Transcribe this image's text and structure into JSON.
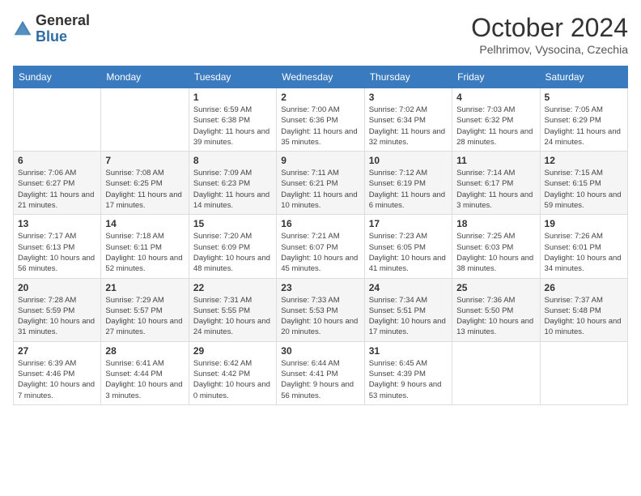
{
  "header": {
    "logo_general": "General",
    "logo_blue": "Blue",
    "month_title": "October 2024",
    "subtitle": "Pelhrimov, Vysocina, Czechia"
  },
  "calendar": {
    "days_of_week": [
      "Sunday",
      "Monday",
      "Tuesday",
      "Wednesday",
      "Thursday",
      "Friday",
      "Saturday"
    ],
    "weeks": [
      [
        {
          "day": "",
          "info": ""
        },
        {
          "day": "",
          "info": ""
        },
        {
          "day": "1",
          "info": "Sunrise: 6:59 AM\nSunset: 6:38 PM\nDaylight: 11 hours and 39 minutes."
        },
        {
          "day": "2",
          "info": "Sunrise: 7:00 AM\nSunset: 6:36 PM\nDaylight: 11 hours and 35 minutes."
        },
        {
          "day": "3",
          "info": "Sunrise: 7:02 AM\nSunset: 6:34 PM\nDaylight: 11 hours and 32 minutes."
        },
        {
          "day": "4",
          "info": "Sunrise: 7:03 AM\nSunset: 6:32 PM\nDaylight: 11 hours and 28 minutes."
        },
        {
          "day": "5",
          "info": "Sunrise: 7:05 AM\nSunset: 6:29 PM\nDaylight: 11 hours and 24 minutes."
        }
      ],
      [
        {
          "day": "6",
          "info": "Sunrise: 7:06 AM\nSunset: 6:27 PM\nDaylight: 11 hours and 21 minutes."
        },
        {
          "day": "7",
          "info": "Sunrise: 7:08 AM\nSunset: 6:25 PM\nDaylight: 11 hours and 17 minutes."
        },
        {
          "day": "8",
          "info": "Sunrise: 7:09 AM\nSunset: 6:23 PM\nDaylight: 11 hours and 14 minutes."
        },
        {
          "day": "9",
          "info": "Sunrise: 7:11 AM\nSunset: 6:21 PM\nDaylight: 11 hours and 10 minutes."
        },
        {
          "day": "10",
          "info": "Sunrise: 7:12 AM\nSunset: 6:19 PM\nDaylight: 11 hours and 6 minutes."
        },
        {
          "day": "11",
          "info": "Sunrise: 7:14 AM\nSunset: 6:17 PM\nDaylight: 11 hours and 3 minutes."
        },
        {
          "day": "12",
          "info": "Sunrise: 7:15 AM\nSunset: 6:15 PM\nDaylight: 10 hours and 59 minutes."
        }
      ],
      [
        {
          "day": "13",
          "info": "Sunrise: 7:17 AM\nSunset: 6:13 PM\nDaylight: 10 hours and 56 minutes."
        },
        {
          "day": "14",
          "info": "Sunrise: 7:18 AM\nSunset: 6:11 PM\nDaylight: 10 hours and 52 minutes."
        },
        {
          "day": "15",
          "info": "Sunrise: 7:20 AM\nSunset: 6:09 PM\nDaylight: 10 hours and 48 minutes."
        },
        {
          "day": "16",
          "info": "Sunrise: 7:21 AM\nSunset: 6:07 PM\nDaylight: 10 hours and 45 minutes."
        },
        {
          "day": "17",
          "info": "Sunrise: 7:23 AM\nSunset: 6:05 PM\nDaylight: 10 hours and 41 minutes."
        },
        {
          "day": "18",
          "info": "Sunrise: 7:25 AM\nSunset: 6:03 PM\nDaylight: 10 hours and 38 minutes."
        },
        {
          "day": "19",
          "info": "Sunrise: 7:26 AM\nSunset: 6:01 PM\nDaylight: 10 hours and 34 minutes."
        }
      ],
      [
        {
          "day": "20",
          "info": "Sunrise: 7:28 AM\nSunset: 5:59 PM\nDaylight: 10 hours and 31 minutes."
        },
        {
          "day": "21",
          "info": "Sunrise: 7:29 AM\nSunset: 5:57 PM\nDaylight: 10 hours and 27 minutes."
        },
        {
          "day": "22",
          "info": "Sunrise: 7:31 AM\nSunset: 5:55 PM\nDaylight: 10 hours and 24 minutes."
        },
        {
          "day": "23",
          "info": "Sunrise: 7:33 AM\nSunset: 5:53 PM\nDaylight: 10 hours and 20 minutes."
        },
        {
          "day": "24",
          "info": "Sunrise: 7:34 AM\nSunset: 5:51 PM\nDaylight: 10 hours and 17 minutes."
        },
        {
          "day": "25",
          "info": "Sunrise: 7:36 AM\nSunset: 5:50 PM\nDaylight: 10 hours and 13 minutes."
        },
        {
          "day": "26",
          "info": "Sunrise: 7:37 AM\nSunset: 5:48 PM\nDaylight: 10 hours and 10 minutes."
        }
      ],
      [
        {
          "day": "27",
          "info": "Sunrise: 6:39 AM\nSunset: 4:46 PM\nDaylight: 10 hours and 7 minutes."
        },
        {
          "day": "28",
          "info": "Sunrise: 6:41 AM\nSunset: 4:44 PM\nDaylight: 10 hours and 3 minutes."
        },
        {
          "day": "29",
          "info": "Sunrise: 6:42 AM\nSunset: 4:42 PM\nDaylight: 10 hours and 0 minutes."
        },
        {
          "day": "30",
          "info": "Sunrise: 6:44 AM\nSunset: 4:41 PM\nDaylight: 9 hours and 56 minutes."
        },
        {
          "day": "31",
          "info": "Sunrise: 6:45 AM\nSunset: 4:39 PM\nDaylight: 9 hours and 53 minutes."
        },
        {
          "day": "",
          "info": ""
        },
        {
          "day": "",
          "info": ""
        }
      ]
    ]
  }
}
